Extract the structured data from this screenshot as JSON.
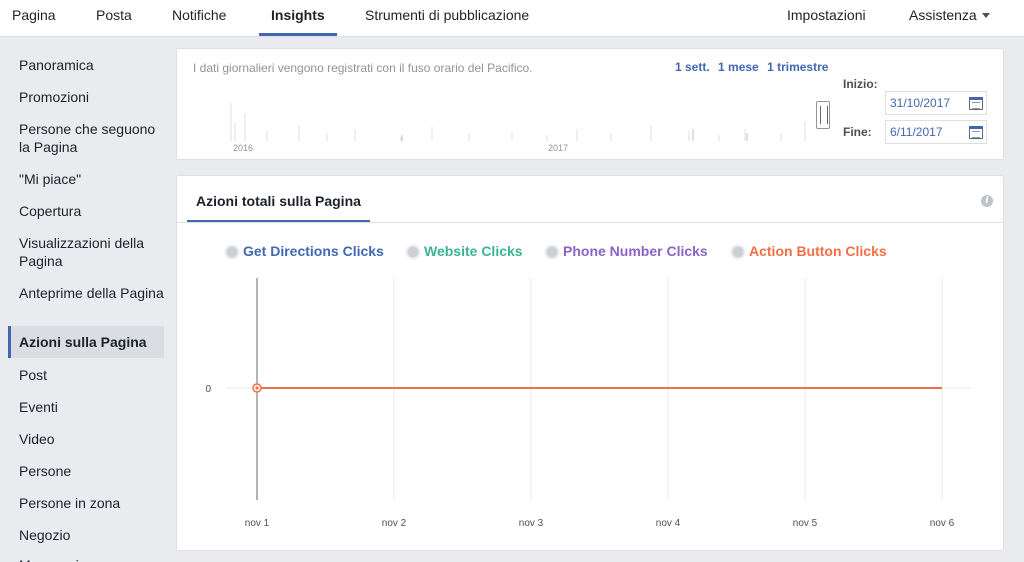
{
  "topnav": {
    "items": [
      "Pagina",
      "Posta",
      "Notifiche",
      "Insights",
      "Strumenti di pubblicazione"
    ],
    "settings": "Impostazioni",
    "help": "Assistenza"
  },
  "sidebar": {
    "items": [
      "Panoramica",
      "Promozioni",
      "Persone che seguono la Pagina",
      "\"Mi piace\"",
      "Copertura",
      "Visualizzazioni della Pagina",
      "Anteprime della Pagina",
      "Azioni sulla Pagina",
      "Post",
      "Eventi",
      "Video",
      "Persone",
      "Persone in zona",
      "Negozio",
      "Messaggi"
    ],
    "active_index": 7
  },
  "range_card": {
    "timezone_note": "I dati giornalieri vengono registrati con il fuso orario del Pacifico.",
    "ranges": [
      "1 sett.",
      "1 mese",
      "1 trimestre"
    ],
    "years": [
      "2016",
      "2017"
    ],
    "start_label": "Inizio:",
    "start_value": "31/10/2017",
    "end_label": "Fine:",
    "end_value": "6/11/2017"
  },
  "chart_card": {
    "tab": "Azioni totali sulla Pagina",
    "info_glyph": "i"
  },
  "colors": {
    "accent": "#4267b2",
    "get_directions": "#4267b2",
    "website": "#3ab593",
    "phone": "#8c62c5",
    "action_button": "#f36e44"
  },
  "chart_data": {
    "type": "line",
    "categories": [
      "nov 1",
      "nov 2",
      "nov 3",
      "nov 4",
      "nov 5",
      "nov 6"
    ],
    "series": [
      {
        "name": "Get Directions Clicks",
        "values": [
          0,
          0,
          0,
          0,
          0,
          0
        ]
      },
      {
        "name": "Website Clicks",
        "values": [
          0,
          0,
          0,
          0,
          0,
          0
        ]
      },
      {
        "name": "Phone Number Clicks",
        "values": [
          0,
          0,
          0,
          0,
          0,
          0
        ]
      },
      {
        "name": "Action Button Clicks",
        "values": [
          0,
          0,
          0,
          0,
          0,
          0
        ]
      }
    ],
    "yticks": [
      "0"
    ],
    "legend": "top",
    "grid": true
  }
}
